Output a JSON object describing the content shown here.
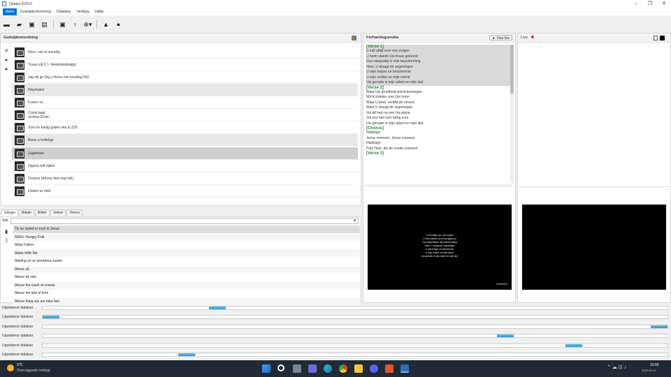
{
  "window": {
    "title": "Quelea 2020.0"
  },
  "menu": [
    "Arkiv",
    "Gudstjänstordning",
    "Databas",
    "Verktyg",
    "Hjälp"
  ],
  "toolbar": {
    "icons": [
      "new-icon",
      "open-icon",
      "save-icon",
      "print-icon",
      "save-as-icon",
      "lightbulb-icon",
      "add-icon",
      "warning-icon",
      "record-icon"
    ]
  },
  "service": {
    "title": "Gudstjänstordning",
    "items": [
      {
        "lines": [
          "Here I am to worship"
        ]
      },
      {
        "lines": [
          "Trouw zijt U (- Nederlandstalig)"
        ]
      },
      {
        "lines": [
          "Jag vill ge Dig o Herre min lovsång 318"
        ]
      },
      {
        "lines": [
          "Waymaker"
        ]
      },
      {
        "lines": [
          "It were zu"
        ]
      },
      {
        "lines": [
          "O pris bagt",
          "Joshua Grote"
        ]
      },
      {
        "lines": [
          "Som en harlig guden ska tu  220"
        ]
      },
      {
        "lines": [
          "Baise a helleluja"
        ]
      },
      {
        "lines": [
          "Zagdream"
        ]
      },
      {
        "lines": [
          "Oppna mitt hjärta"
        ]
      },
      {
        "lines": [
          "Oceans (Where feet may fail)"
        ]
      },
      {
        "lines": [
          "Undert av mild"
        ]
      }
    ]
  },
  "library": {
    "tabs": [
      "Sånger",
      "Bibeln",
      "Bilder",
      "Videor",
      "Timers"
    ],
    "search_label": "Sök",
    "songs": [
      "Tis so sweet to trust in Jesus",
      "5000+ Hungry Folk",
      "Abba Father",
      "Abide With Me",
      "Abiding oh so wondrous sweet",
      "Above all",
      "Above all else",
      "Above the clash of creeds",
      "Above the tide of time",
      "Above thing are are take fast"
    ]
  },
  "preview": {
    "title": "Förhandsgranska",
    "live_button": "Visa live",
    "blocks": [
      {
        "label": "[Verse 1]",
        "lines": [
          "U zult altijd voor ons zorgen",
          "U heim steeds Uw trouw getoond",
          "Dus rampzalig is mijn bescherming",
          "Heer, U draagt de zegeningen",
          "U mijn helper en beschermer",
          "U mijn redder en mijn vriend",
          "Uw genade is mijn adem en mijn lied"
        ]
      },
      {
        "label": "[Verse 2]",
        "lines": [
          "Waar Uw grootheid wordt bezongen",
          "Wil ik knielen voor Uw troon",
          "Waar U bent, verdikt de omrust",
          "Want U draagt de zegeningen",
          "Vul dit hart nu met Uw glorie",
          "Vul ons hart met heilig vuur",
          "Uw genade is mijn adem en mijn lied"
        ]
      },
      {
        "label": "[Chorus]",
        "lines": [
          "Halleluja!",
          "Jezus overwon, Jezus overwon",
          "Halleluja!",
          "Prijs Heer, die de zonde overwon"
        ]
      },
      {
        "label": "[Verse 3]",
        "lines": []
      }
    ],
    "screen_lines": [
      "U zult altijd voor ons zorgen",
      "U heim steeds Uw trouw getoond",
      "Dus rampzalig is mijn bescherming",
      "Heer, U draagt de zegeningen",
      "U mijn helper en beschermer",
      "U mijn redder en mijn vriend",
      "Uw genade is mijn adem en mijn lied"
    ],
    "screen_credit": "Onbekend"
  },
  "live": {
    "title": "Live"
  },
  "progress": {
    "label": "Uppdaterar databas",
    "values": [
      0.28,
      0.02,
      0.97,
      0.74,
      0.85,
      0.23
    ]
  },
  "taskbar": {
    "weather_temp": "9°C",
    "weather_text": "Övervägande molnigt",
    "time": "10:00",
    "date": "2022-04-10"
  }
}
